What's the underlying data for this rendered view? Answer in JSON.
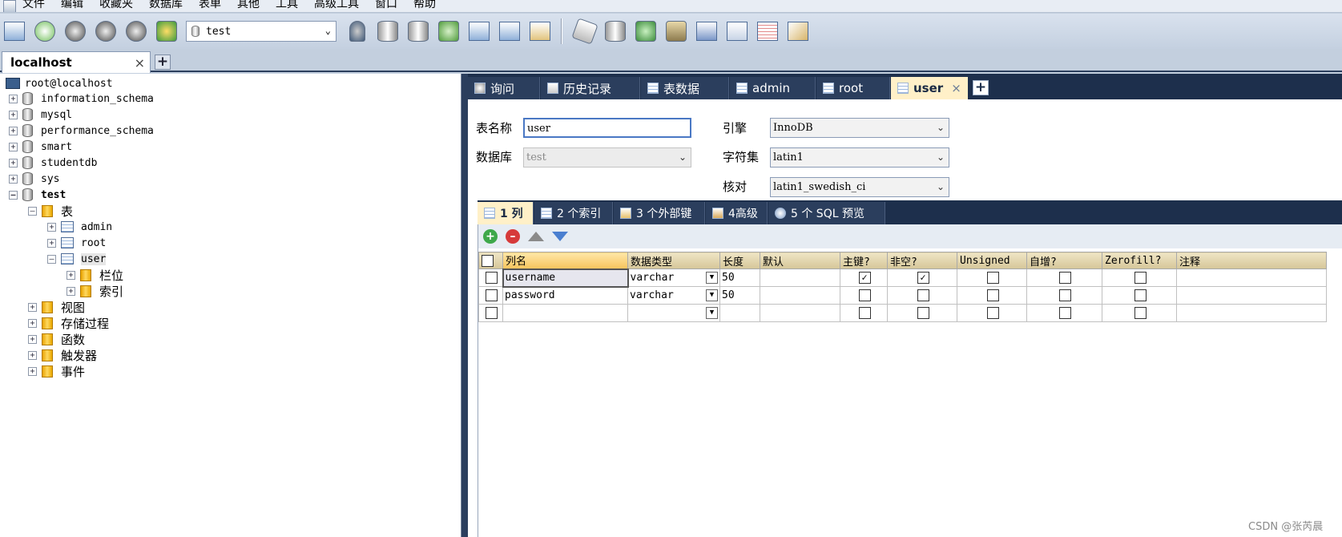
{
  "menu": [
    "文件",
    "编辑",
    "收藏夹",
    "数据库",
    "表单",
    "其他",
    "工具",
    "高级工具",
    "窗口",
    "帮助"
  ],
  "toolbar": {
    "db_selector_value": "test"
  },
  "connection_tab": {
    "label": "localhost"
  },
  "tree": {
    "root": "root@localhost",
    "databases": [
      "information_schema",
      "mysql",
      "performance_schema",
      "smart",
      "studentdb",
      "sys"
    ],
    "active_db": "test",
    "tables_folder": "表",
    "tables": [
      "admin",
      "root",
      "user"
    ],
    "user_children": [
      "栏位",
      "索引"
    ],
    "other_folders": [
      "视图",
      "存储过程",
      "函数",
      "触发器",
      "事件"
    ]
  },
  "object_tabs": [
    "询问",
    "历史记录",
    "表数据",
    "admin",
    "root",
    "user"
  ],
  "form": {
    "table_name_label": "表名称",
    "table_name_value": "user",
    "database_label": "数据库",
    "database_value": "test",
    "engine_label": "引擎",
    "engine_value": "InnoDB",
    "charset_label": "字符集",
    "charset_value": "latin1",
    "collation_label": "核对",
    "collation_value": "latin1_swedish_ci"
  },
  "sub_tabs": [
    "1 列",
    "2 个索引",
    "3 个外部键",
    "4高级",
    "5 个 SQL 预览"
  ],
  "columns_grid": {
    "headers": [
      "列名",
      "数据类型",
      "长度",
      "默认",
      "主键?",
      "非空?",
      "Unsigned",
      "自增?",
      "Zerofill?",
      "注释"
    ],
    "rows": [
      {
        "name": "username",
        "type": "varchar",
        "length": "50",
        "pk": true,
        "notnull": true
      },
      {
        "name": "password",
        "type": "varchar",
        "length": "50",
        "pk": false,
        "notnull": false
      },
      {
        "name": "",
        "type": "",
        "length": "",
        "pk": false,
        "notnull": false
      }
    ]
  },
  "watermark": "CSDN @张芮晨"
}
